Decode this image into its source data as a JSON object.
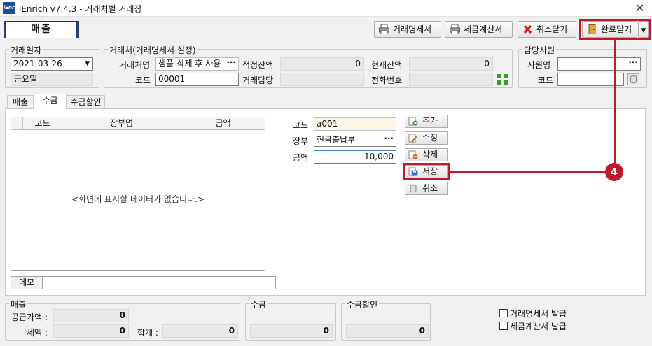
{
  "window": {
    "logo_text": "iEnr",
    "title": "iEnrich v7.4.3 - 거래처별 거래장",
    "close_glyph": "✕"
  },
  "toolbar": {
    "mode_label": "매출",
    "statement_btn": "거래명세서",
    "tax_invoice_btn": "세금계산서",
    "cancel_close_btn": "취소닫기",
    "complete_close_btn": "완료닫기"
  },
  "trade_date": {
    "group_title": "거래일자",
    "date_value": "2021-03-26",
    "weekday": "금요일"
  },
  "partner": {
    "group_title": "거래처(거래명세서 설정)",
    "name_label": "거래처명",
    "name_value": "샘플-삭제 후 사용",
    "code_label": "코드",
    "code_value": "00001",
    "proper_balance_label": "적정잔액",
    "proper_balance_value": "0",
    "current_balance_label": "현재잔액",
    "current_balance_value": "0",
    "manager_label": "거래담당",
    "manager_value": "",
    "phone_label": "전화번호",
    "phone_value": ""
  },
  "staff": {
    "group_title": "담당사원",
    "name_label": "사원명",
    "name_value": "",
    "code_label": "코드",
    "code_value": ""
  },
  "tabs": [
    {
      "label": "매출"
    },
    {
      "label": "수금"
    },
    {
      "label": "수금할인"
    }
  ],
  "grid": {
    "columns": [
      "코드",
      "장부명",
      "금액"
    ],
    "empty_message": "<화면에 표시할 데이터가 없습니다.>"
  },
  "memo": {
    "label": "메모",
    "value": ""
  },
  "form": {
    "code_label": "코드",
    "code_value": "a001",
    "ledger_label": "장부",
    "ledger_value": "현금출납부",
    "amount_label": "금액",
    "amount_value": "10,000"
  },
  "side_buttons": {
    "add": "추가",
    "edit": "수정",
    "delete": "삭제",
    "save": "저장",
    "cancel": "취소"
  },
  "summary": {
    "sales_title": "매출",
    "supply_label": "공급가액 :",
    "supply_value": "0",
    "tax_label": "세액 :",
    "tax_value": "0",
    "total_label": "합계 :",
    "total_value": "0",
    "collection_title": "수금",
    "collection_value": "0",
    "discount_title": "수금할인",
    "discount_value": "0"
  },
  "issue": {
    "statement_issue": "거래명세서 발급",
    "tax_invoice_issue": "세금계산서 발급"
  },
  "callout": {
    "number": "4"
  },
  "colors": {
    "highlight": "#c0192a",
    "brand": "#2b3c7a"
  }
}
